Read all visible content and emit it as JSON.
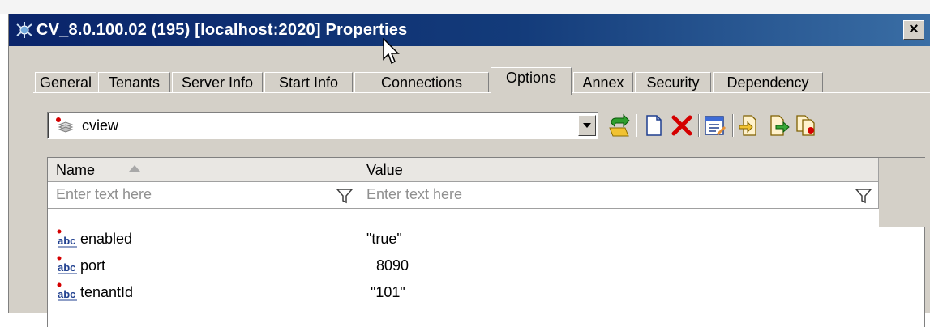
{
  "window": {
    "title": "CV_8.0.100.02 (195) [localhost:2020] Properties",
    "close_glyph": "×"
  },
  "tabs": [
    {
      "label": "General"
    },
    {
      "label": "Tenants"
    },
    {
      "label": "Server Info"
    },
    {
      "label": "Start Info"
    },
    {
      "label": "Connections"
    },
    {
      "label": "Options",
      "active": true
    },
    {
      "label": "Annex"
    },
    {
      "label": "Security"
    },
    {
      "label": "Dependency"
    }
  ],
  "section_combo": {
    "value": "cview",
    "icon": "section-layers-icon"
  },
  "toolbar": {
    "icons": [
      "up-folder-icon",
      "new-document-icon",
      "delete-x-icon",
      "edit-properties-icon",
      "import-icon",
      "export-icon",
      "copy-icon"
    ]
  },
  "grid": {
    "columns": [
      {
        "header": "Name",
        "filter_placeholder": "Enter text here"
      },
      {
        "header": "Value",
        "filter_placeholder": "Enter text here"
      }
    ],
    "rows": [
      {
        "name": "enabled",
        "value": "\"true\"",
        "icon": "string-abc-icon"
      },
      {
        "name": "port",
        "value": "8090",
        "icon": "string-abc-icon"
      },
      {
        "name": "tenantId",
        "value": "\"101\"",
        "icon": "string-abc-icon"
      }
    ]
  },
  "colors": {
    "titlebar_dark": "#0a246a",
    "titlebar_light": "#3a6ea5",
    "dialog_face": "#d4d0c8",
    "delete_red": "#d40000"
  }
}
